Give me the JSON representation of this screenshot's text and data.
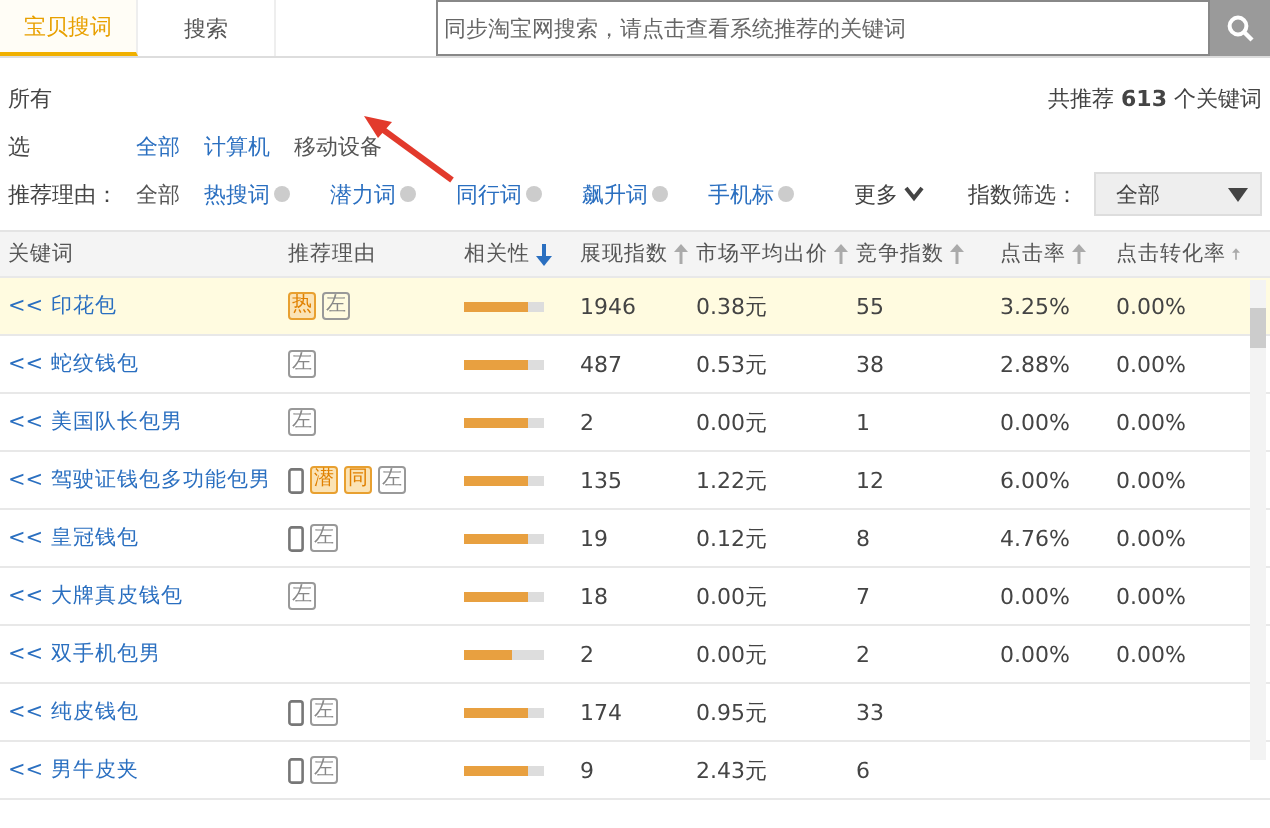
{
  "tabs": [
    {
      "label": "宝贝搜词",
      "selected": true
    },
    {
      "label": "搜索",
      "selected": false
    }
  ],
  "search": {
    "placeholder": "同步淘宝网搜索，请点击查看系统推荐的关键词"
  },
  "summary": {
    "label": "所有",
    "count": "共推荐 **613** 个关键词"
  },
  "device_filter": {
    "label": "选",
    "options": [
      {
        "label": "全部",
        "selected": false
      },
      {
        "label": "计算机",
        "selected": false
      },
      {
        "label": "移动设备",
        "selected": true
      }
    ]
  },
  "reason_filter": {
    "label": "推荐理由：",
    "options": [
      {
        "label": "全部",
        "selected": true,
        "badge": false
      },
      {
        "label": "热搜词",
        "selected": false,
        "badge": true
      },
      {
        "label": "潜力词",
        "selected": false,
        "badge": true
      },
      {
        "label": "同行词",
        "selected": false,
        "badge": true
      },
      {
        "label": "飙升词",
        "selected": false,
        "badge": true
      },
      {
        "label": "手机标",
        "selected": false,
        "badge": true
      }
    ],
    "more": "更多"
  },
  "index_filter": {
    "label": "指数筛选：",
    "value": "全部"
  },
  "table": {
    "columns": [
      {
        "label": "关键词",
        "sortable": false,
        "sorted": false
      },
      {
        "label": "推荐理由",
        "sortable": false,
        "sorted": false
      },
      {
        "label": "相关性",
        "sortable": true,
        "sorted": true
      },
      {
        "label": "展现指数",
        "sortable": true,
        "sorted": false
      },
      {
        "label": "市场平均出价",
        "sortable": true,
        "sorted": false
      },
      {
        "label": "竞争指数",
        "sortable": true,
        "sorted": false
      },
      {
        "label": "点击率",
        "sortable": true,
        "sorted": false
      },
      {
        "label": "点击转化率",
        "sortable": true,
        "sorted": false
      }
    ],
    "rows": [
      {
        "selected": true,
        "cells": [
          {
            "prefix": "<<",
            "keyword": "印花包"
          },
          {
            "tags": [
              {
                "kind": "tag",
                "text": "热",
                "highlighted": true
              },
              {
                "kind": "tag",
                "text": "左",
                "highlighted": false
              }
            ]
          },
          {
            "level": 0.8
          },
          "1946",
          "0.38元",
          "55",
          "3.25%",
          "0.00%"
        ]
      },
      {
        "selected": false,
        "cells": [
          {
            "prefix": "<<",
            "keyword": "蛇纹钱包"
          },
          {
            "tags": [
              {
                "kind": "tag",
                "text": "左",
                "highlighted": false
              }
            ]
          },
          {
            "level": 0.8
          },
          "487",
          "0.53元",
          "38",
          "2.88%",
          "0.00%"
        ]
      },
      {
        "selected": false,
        "cells": [
          {
            "prefix": "<<",
            "keyword": "美国队长包男"
          },
          {
            "tags": [
              {
                "kind": "tag",
                "text": "左",
                "highlighted": false
              }
            ]
          },
          {
            "level": 0.8
          },
          "2",
          "0.00元",
          "1",
          "0.00%",
          "0.00%"
        ]
      },
      {
        "selected": false,
        "cells": [
          {
            "prefix": "<<",
            "keyword": "驾驶证钱包多功能包男"
          },
          {
            "tags": [
              {
                "kind": "phone"
              },
              {
                "kind": "tag",
                "text": "潜",
                "highlighted": true
              },
              {
                "kind": "tag",
                "text": "同",
                "highlighted": true
              },
              {
                "kind": "tag",
                "text": "左",
                "highlighted": false
              }
            ]
          },
          {
            "level": 0.8
          },
          "135",
          "1.22元",
          "12",
          "6.00%",
          "0.00%"
        ]
      },
      {
        "selected": false,
        "cells": [
          {
            "prefix": "<<",
            "keyword": "皇冠钱包"
          },
          {
            "tags": [
              {
                "kind": "phone"
              },
              {
                "kind": "tag",
                "text": "左",
                "highlighted": false
              }
            ]
          },
          {
            "level": 0.8
          },
          "19",
          "0.12元",
          "8",
          "4.76%",
          "0.00%"
        ]
      },
      {
        "selected": false,
        "cells": [
          {
            "prefix": "<<",
            "keyword": "大牌真皮钱包"
          },
          {
            "tags": [
              {
                "kind": "tag",
                "text": "左",
                "highlighted": false
              }
            ]
          },
          {
            "level": 0.8
          },
          "18",
          "0.00元",
          "7",
          "0.00%",
          "0.00%"
        ]
      },
      {
        "selected": false,
        "cells": [
          {
            "prefix": "<<",
            "keyword": "双手机包男"
          },
          {},
          {
            "level": 0.6
          },
          "2",
          "0.00元",
          "2",
          "0.00%",
          "0.00%"
        ]
      },
      {
        "selected": false,
        "cells": [
          {
            "prefix": "<<",
            "keyword": "纯皮钱包"
          },
          {
            "tags": [
              {
                "kind": "phone"
              },
              {
                "kind": "tag",
                "text": "左",
                "highlighted": false
              }
            ]
          },
          {
            "level": 0.8
          },
          "174",
          "0.95元",
          "33"
        ]
      },
      {
        "selected": false,
        "cells": [
          {
            "prefix": "<<",
            "keyword": "男牛皮夹"
          },
          {
            "tags": [
              {
                "kind": "phone"
              },
              {
                "kind": "tag",
                "text": "左",
                "highlighted": false
              }
            ]
          },
          {
            "level": 0.8
          },
          "9",
          "2.43元",
          "6"
        ]
      }
    ]
  },
  "annotation": {
    "kind": "arrow"
  }
}
